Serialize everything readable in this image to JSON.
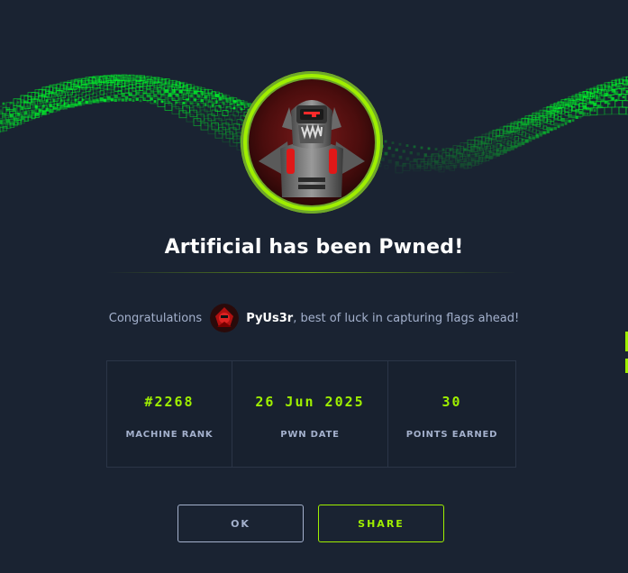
{
  "banner": {
    "icon": "matrix-cubes-wave",
    "accent": "#00ff2a"
  },
  "machine": {
    "avatar_icon": "robot-machine-avatar",
    "ring_color": "#9fef00"
  },
  "title": "Artificial has been Pwned!",
  "congrats": {
    "prefix": "Congratulations",
    "username": "PyUs3r",
    "suffix": ", best of luck in capturing flags ahead!",
    "user_avatar_icon": "user-avatar"
  },
  "stats": [
    {
      "value": "#2268",
      "label": "MACHINE RANK"
    },
    {
      "value": "26 Jun 2025",
      "label": "PWN DATE"
    },
    {
      "value": "30",
      "label": "POINTS EARNED"
    }
  ],
  "buttons": {
    "ok": "OK",
    "share": "SHARE"
  },
  "colors": {
    "background": "#1a2332",
    "accent": "#9fef00",
    "muted": "#a4b1cd"
  }
}
